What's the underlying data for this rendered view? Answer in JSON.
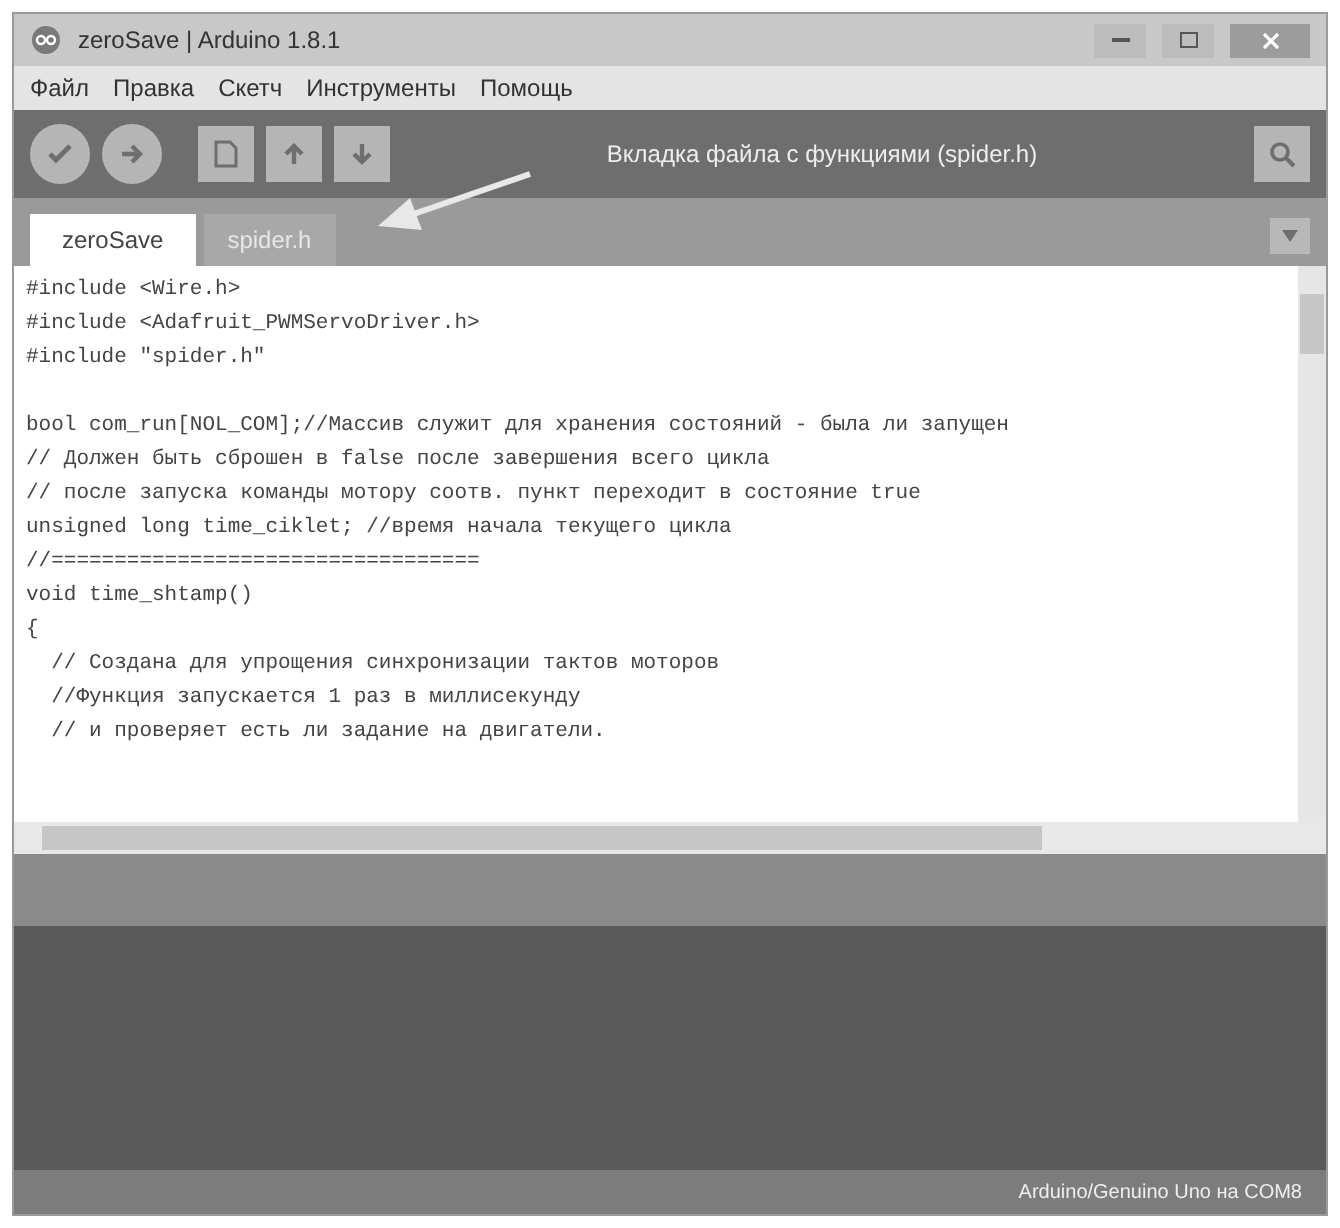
{
  "window": {
    "title": "zeroSave | Arduino 1.8.1"
  },
  "menu": [
    "Файл",
    "Правка",
    "Скетч",
    "Инструменты",
    "Помощь"
  ],
  "annotation": "Вкладка файла с функциями (spider.h)",
  "tabs": [
    {
      "label": "zeroSave",
      "selected": true
    },
    {
      "label": "spider.h",
      "selected": false
    }
  ],
  "code_blocks": [
    [
      "#include <Wire.h>",
      "#include <Adafruit_PWMServoDriver.h>",
      "#include \"spider.h\""
    ],
    [
      "bool com_run[NOL_COM];//Массив служит для хранения состояний - была ли запущен",
      "// Должен быть сброшен в false после завершения всего цикла",
      "// после запуска команды мотору соотв. пункт переходит в состояние true",
      "unsigned long time_ciklet; //время начала текущего цикла",
      "//==================================",
      "void time_shtamp()",
      "{",
      "  // Создана для упрощения синхронизации тактов моторов",
      "  //Функция запускается 1 раз в миллисекунду",
      "  // и проверяет есть ли задание на двигатели."
    ]
  ],
  "status_bar": "Arduino/Genuino Uno на COM8"
}
